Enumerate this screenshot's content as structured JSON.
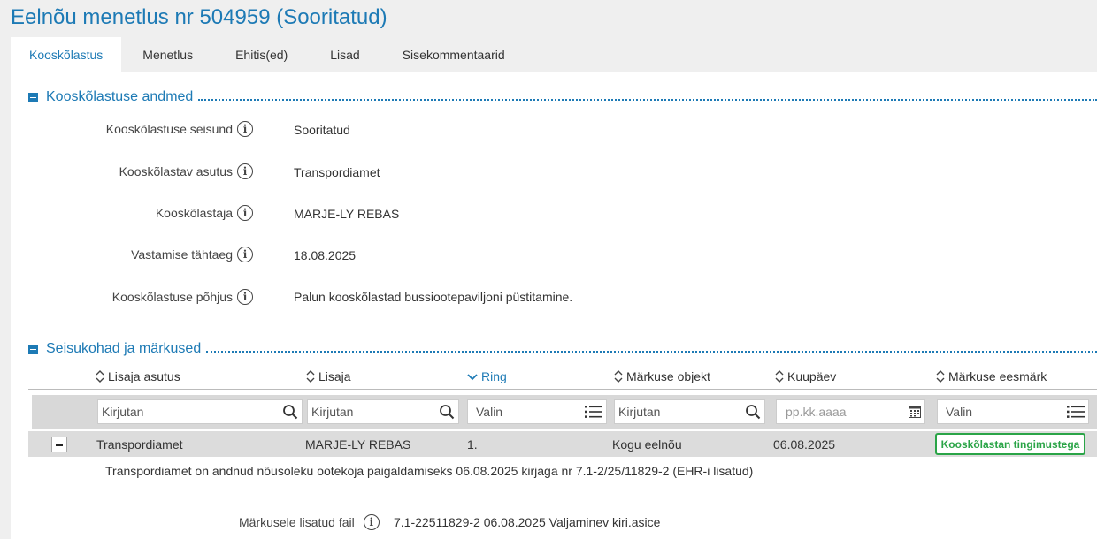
{
  "page": {
    "title": "Eelnõu menetlus nr 504959 (Sooritatud)"
  },
  "tabs": [
    {
      "label": "Kooskõlastus"
    },
    {
      "label": "Menetlus"
    },
    {
      "label": "Ehitis(ed)"
    },
    {
      "label": "Lisad"
    },
    {
      "label": "Sisekommentaarid"
    }
  ],
  "section1": {
    "title": "Kooskõlastuse andmed",
    "fields": [
      {
        "label": "Kooskõlastuse seisund",
        "value": "Sooritatud"
      },
      {
        "label": "Kooskõlastav asutus",
        "value": "Transpordiamet"
      },
      {
        "label": "Kooskõlastaja",
        "value": "MARJE-LY REBAS"
      },
      {
        "label": "Vastamise tähtaeg",
        "value": "18.08.2025"
      },
      {
        "label": "Kooskõlastuse põhjus",
        "value": "Palun kooskõlastad bussiootepaviljoni püstitamine."
      }
    ]
  },
  "section2": {
    "title": "Seisukohad ja märkused",
    "columns": [
      "Lisaja asutus",
      "Lisaja",
      "Ring",
      "Märkuse objekt",
      "Kuupäev",
      "Märkuse eesmärk"
    ],
    "filters": [
      "Kirjutan",
      "Kirjutan",
      "Valin",
      "Kirjutan",
      "pp.kk.aaaa",
      "Valin"
    ],
    "row": {
      "asutus": "Transpordiamet",
      "lisaja": "MARJE-LY REBAS",
      "ring": "1.",
      "objekt": "Kogu eelnõu",
      "kuupaev": "06.08.2025",
      "eesmark": "Kooskõlastan tingimustega"
    },
    "comment": "Transpordiamet on andnud nõusoleku ootekoja paigaldamiseks 06.08.2025 kirjaga nr 7.1-2/25/11829-2 (EHR-i lisatud)",
    "file_label": "Märkusele lisatud fail",
    "file_name": "7.1-22511829-2 06.08.2025 Valjaminev kiri.asice"
  },
  "colors": {
    "accent": "#1d7ab5",
    "success": "#2aa447"
  },
  "icons": [
    "info-icon",
    "sort-icon",
    "search-icon",
    "list-icon",
    "calendar-icon",
    "collapse-icon"
  ]
}
